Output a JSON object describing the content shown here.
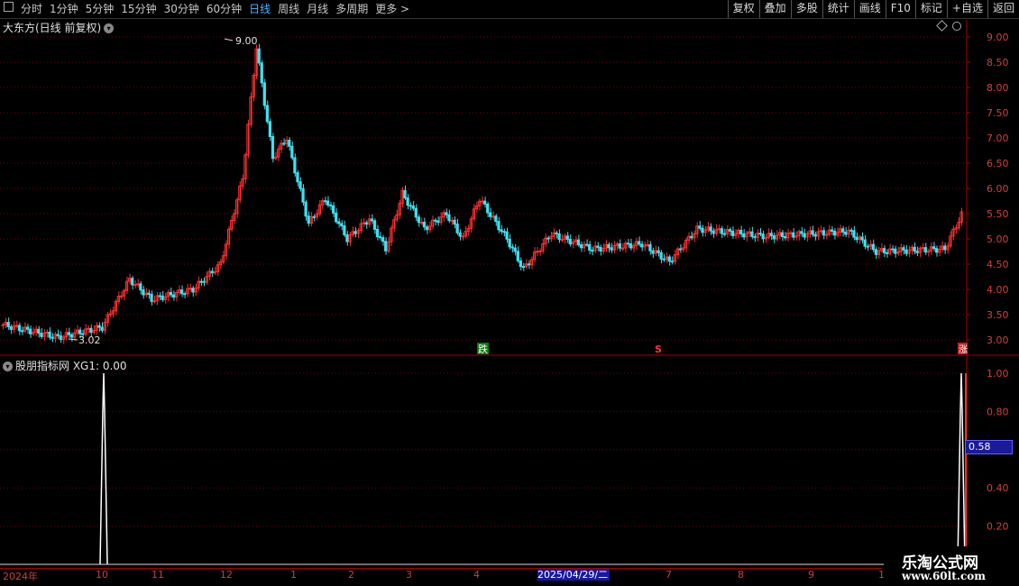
{
  "toolbar": {
    "periods": [
      "分时",
      "1分钟",
      "5分钟",
      "15分钟",
      "30分钟",
      "60分钟",
      "日线",
      "周线",
      "月线",
      "多周期",
      "更多 >"
    ],
    "active_period": "日线",
    "right_buttons": [
      "复权",
      "叠加",
      "多股",
      "统计",
      "画线",
      "F10",
      "标记",
      "+自选",
      "返回"
    ]
  },
  "chart": {
    "title": "大东方(日线 前复权)",
    "high_label": "9.00",
    "low_label": "3.02",
    "markers": {
      "down": "跌",
      "s": "S",
      "up": "涨"
    },
    "price_ticks": [
      "9.00",
      "8.50",
      "8.00",
      "7.50",
      "7.00",
      "6.50",
      "6.00",
      "5.50",
      "5.00",
      "4.50",
      "4.00",
      "3.50",
      "3.00"
    ]
  },
  "indicator": {
    "title": "股朋指标网  XG1: 0.00",
    "ticks": [
      "1.00",
      "0.80",
      "0.40",
      "0.20"
    ],
    "current_value": "0.58"
  },
  "date_axis": {
    "labels": [
      "2024年",
      "10",
      "11",
      "12",
      "1",
      "2",
      "3",
      "4",
      "2025/04/29/二",
      "7",
      "8",
      "9",
      "1"
    ]
  },
  "watermark": {
    "line1": "乐淘公式网",
    "line2": "www.60lt.com"
  },
  "colors": {
    "up": "#ff3030",
    "down": "#40e0f0",
    "bg": "#000000",
    "grid": "#7a0000",
    "axis": "#aa0000"
  }
}
